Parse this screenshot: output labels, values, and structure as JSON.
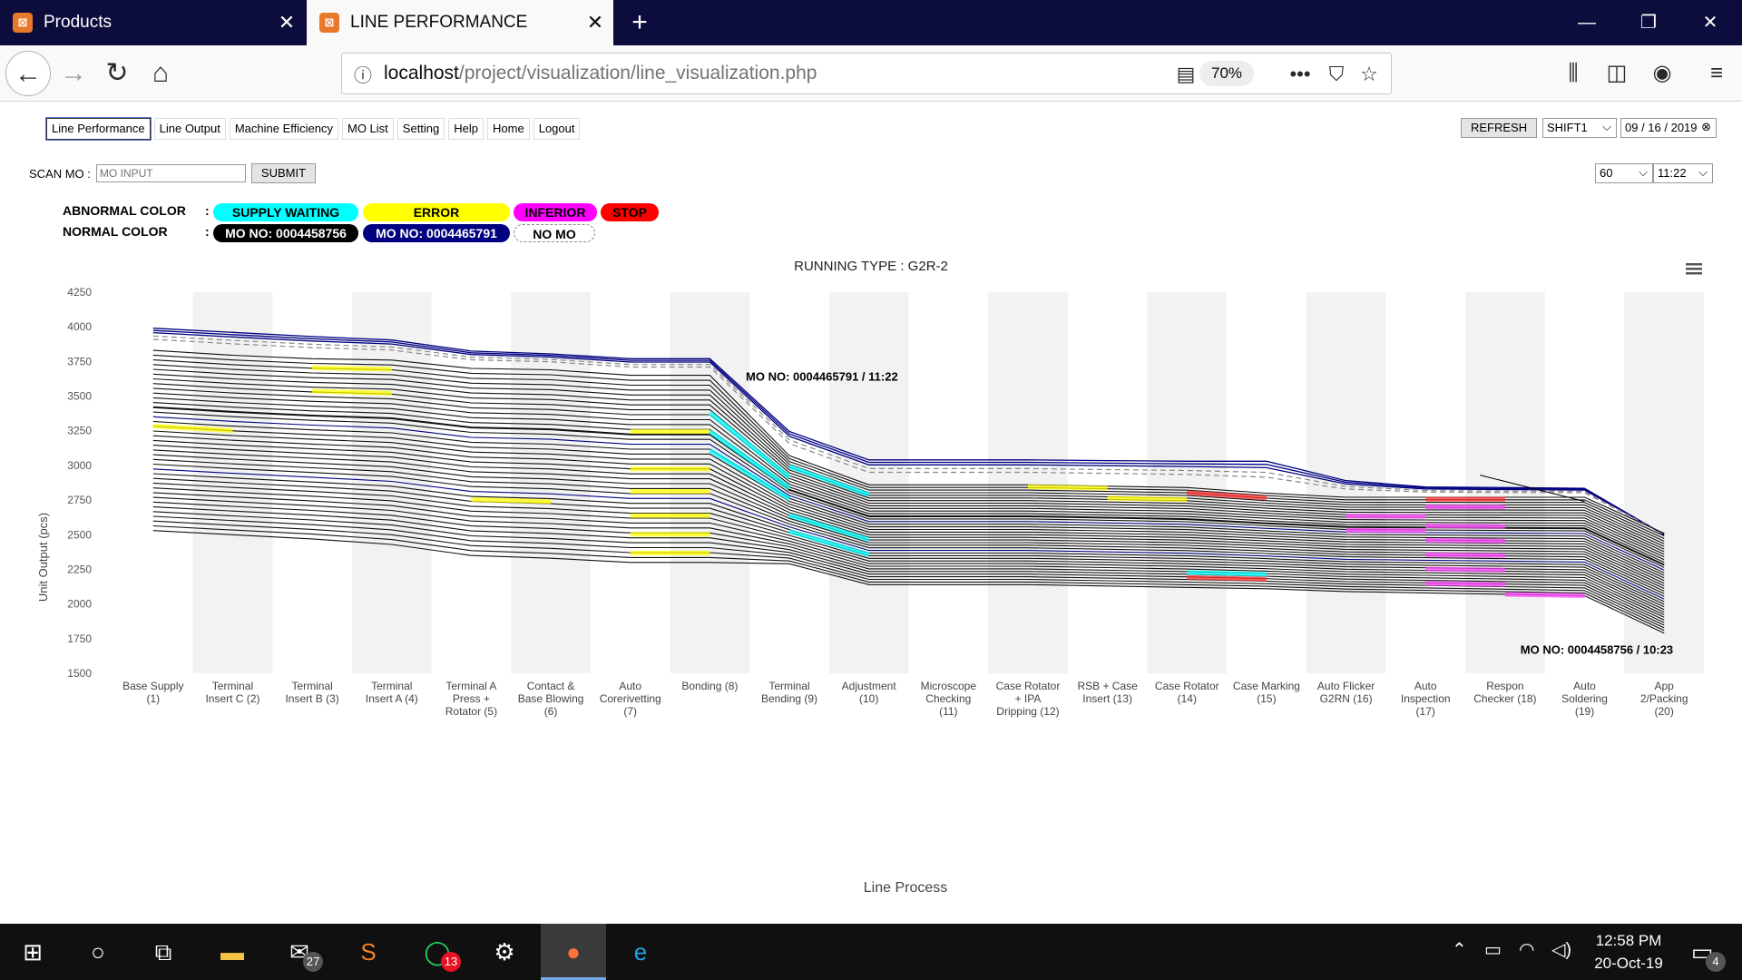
{
  "browser": {
    "tabs": [
      {
        "title": "Products"
      },
      {
        "title": "LINE PERFORMANCE"
      }
    ],
    "url_host": "localhost",
    "url_path": "/project/visualization/line_visualization.php",
    "zoom": "70%"
  },
  "menu": {
    "items": [
      "Line Performance",
      "Line Output",
      "Machine Efficiency",
      "MO List",
      "Setting",
      "Help",
      "Home",
      "Logout"
    ],
    "active": "Line Performance"
  },
  "controls": {
    "refresh_label": "REFRESH",
    "shift_value": "SHIFT1",
    "date_value": "09 / 16 / 2019",
    "interval_value": "60",
    "time_value": "11:22"
  },
  "scan": {
    "label": "SCAN MO :",
    "placeholder": "MO INPUT",
    "submit_label": "SUBMIT"
  },
  "legend": {
    "abnormal_label": "ABNORMAL COLOR",
    "normal_label": "NORMAL COLOR",
    "separator": ":",
    "abnormal": [
      {
        "label": "SUPPLY WAITING",
        "color": "#00ffff"
      },
      {
        "label": "ERROR",
        "color": "#ffff00"
      },
      {
        "label": "INFERIOR",
        "color": "#ff00ff"
      },
      {
        "label": "STOP",
        "color": "#ff0000"
      }
    ],
    "normal": [
      {
        "label": "MO NO: 0004458756",
        "color": "#000000"
      },
      {
        "label": "MO NO: 0004465791",
        "color": "#000080"
      },
      {
        "label": "NO MO",
        "color": "#ffffff"
      }
    ]
  },
  "chart_data": {
    "type": "line",
    "title": "RUNNING TYPE : G2R-2",
    "xlabel": "Line Process",
    "ylabel": "Unit Output (pcs)",
    "ylim": [
      1500,
      4250
    ],
    "yticks": [
      1500,
      1750,
      2000,
      2250,
      2500,
      2750,
      3000,
      3250,
      3500,
      3750,
      4000,
      4250
    ],
    "categories": [
      "Base Supply (1)",
      "Terminal Insert C (2)",
      "Terminal Insert B (3)",
      "Terminal Insert A (4)",
      "Terminal A Press + Rotator (5)",
      "Contact & Base Blowing (6)",
      "Auto Corerivetting (7)",
      "Bonding (8)",
      "Terminal Bending (9)",
      "Adjustment (10)",
      "Microscope Checking (11)",
      "Case Rotator + IPA Dripping (12)",
      "RSB + Case Insert (13)",
      "Case Rotator (14)",
      "Case Marking (15)",
      "Auto Flicker G2RN (16)",
      "Auto Inspection (17)",
      "Respon Checker (18)",
      "Auto Soldering (19)",
      "App 2/Packing (20)"
    ],
    "category_lines": [
      [
        "Base Supply",
        "(1)"
      ],
      [
        "Terminal",
        "Insert C (2)"
      ],
      [
        "Terminal",
        "Insert B (3)"
      ],
      [
        "Terminal",
        "Insert A (4)"
      ],
      [
        "Terminal A",
        "Press +",
        "Rotator (5)"
      ],
      [
        "Contact &",
        "Base Blowing",
        "(6)"
      ],
      [
        "Auto",
        "Corerivetting",
        "(7)"
      ],
      [
        "Bonding (8)"
      ],
      [
        "Terminal",
        "Bending (9)"
      ],
      [
        "Adjustment",
        "(10)"
      ],
      [
        "Microscope",
        "Checking",
        "(11)"
      ],
      [
        "Case Rotator",
        "+ IPA",
        "Dripping (12)"
      ],
      [
        "RSB + Case",
        "Insert (13)"
      ],
      [
        "Case Rotator",
        "(14)"
      ],
      [
        "Case Marking",
        "(15)"
      ],
      [
        "Auto Flicker",
        "G2RN (16)"
      ],
      [
        "Auto",
        "Inspection",
        "(17)"
      ],
      [
        "Respon",
        "Checker (18)"
      ],
      [
        "Auto",
        "Soldering",
        "(19)"
      ],
      [
        "App",
        "2/Packing",
        "(20)"
      ]
    ],
    "series": [
      {
        "mo": "0004465791",
        "color": "#000080",
        "top": [
          3990,
          3960,
          3930,
          3905,
          3825,
          3805,
          3770,
          3770,
          3245,
          3040,
          3040,
          3040,
          3035,
          3030,
          3030,
          2890,
          2845,
          2840,
          2835,
          2500
        ]
      },
      {
        "mo": "0004458756",
        "color": "#000000",
        "top": [
          3830,
          3795,
          3770,
          3760,
          3700,
          3690,
          3650,
          3650,
          3070,
          2860,
          2860,
          2860,
          2850,
          2840,
          2800,
          2770,
          2770,
          2770,
          2770,
          2510
        ]
      },
      {
        "mo": "0004458756",
        "color": "#000000",
        "bottom": [
          2530,
          2500,
          2470,
          2430,
          2350,
          2330,
          2300,
          2300,
          2290,
          2140,
          2140,
          2140,
          2130,
          2120,
          2110,
          2090,
          2080,
          2070,
          2060,
          1790
        ]
      }
    ],
    "annotations": [
      {
        "text": "MO NO: 0004465791 / 11:22",
        "x": "Terminal Bending (9)",
        "y": 3610
      },
      {
        "text": "MO NO: 0004458756 / 10:23",
        "x": "App 2/Packing (20)",
        "y": 1640
      }
    ],
    "grid": "alternating vertical bands",
    "menu_icon": "hamburger-icon"
  },
  "taskbar": {
    "mail_badge": "27",
    "whatsapp_badge": "13",
    "notif_badge": "4",
    "time": "12:58 PM",
    "date": "20-Oct-19"
  }
}
